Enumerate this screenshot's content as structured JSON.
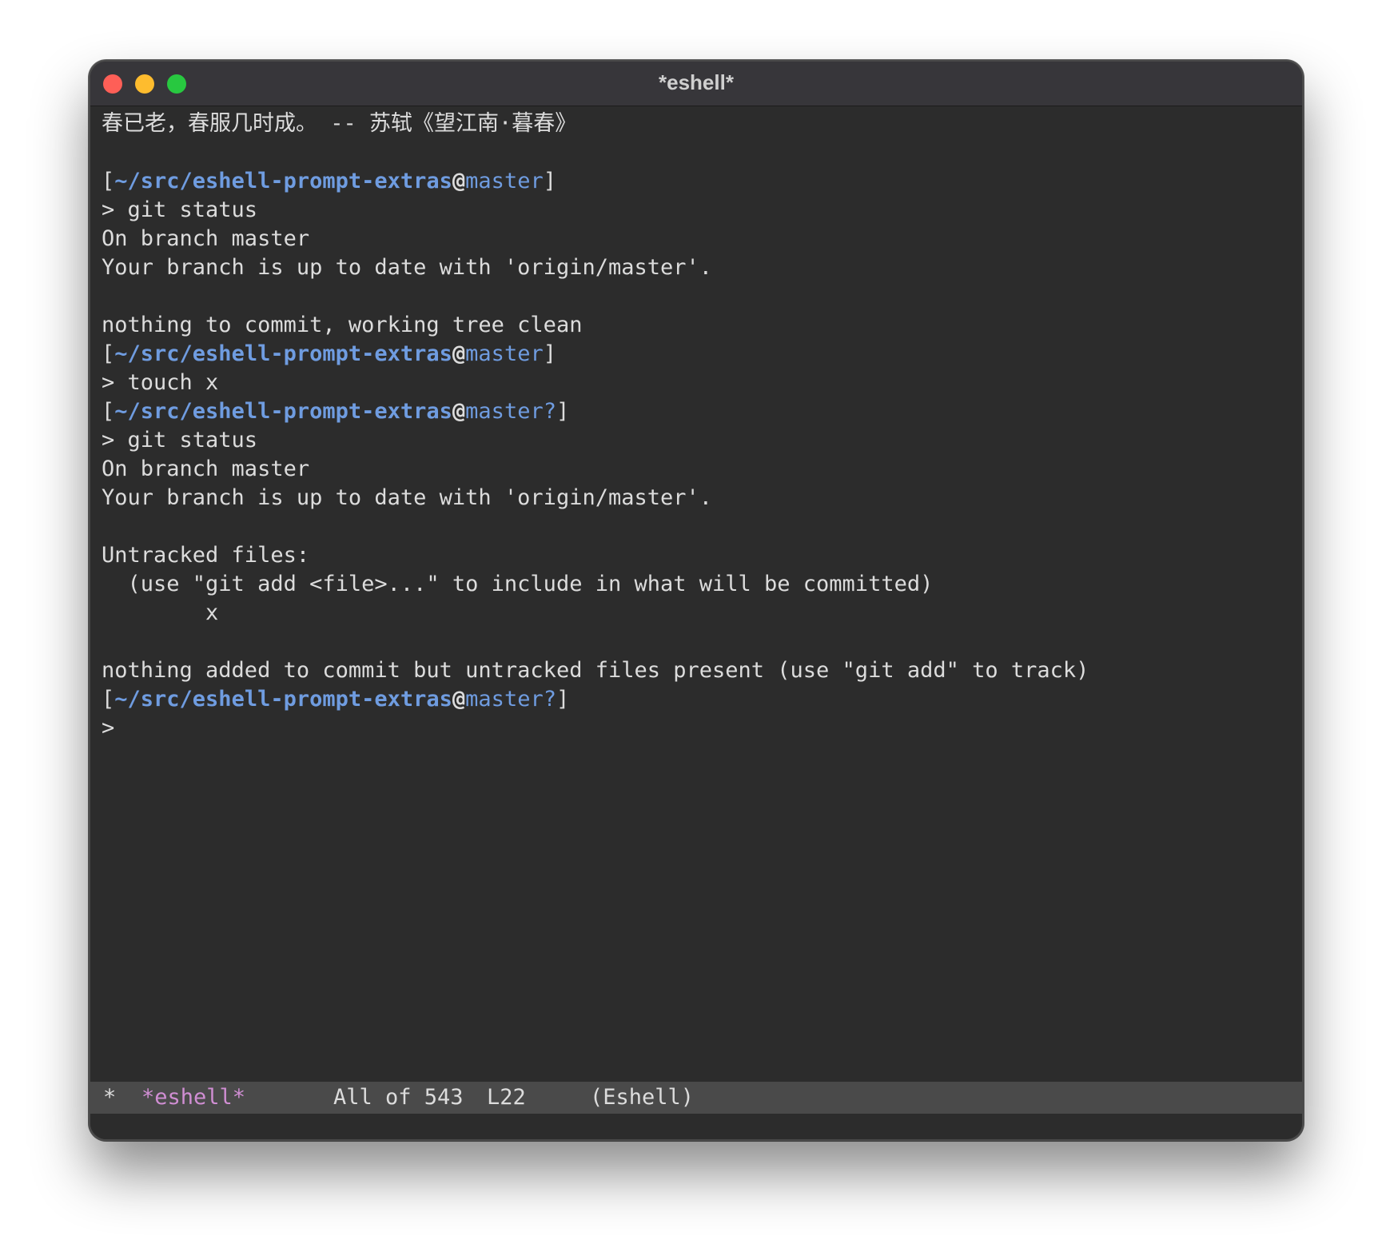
{
  "window": {
    "title": "*eshell*"
  },
  "buffer": {
    "banner": "春已老，春服几时成。 -- 苏轼《望江南·暮春》",
    "prompts": [
      {
        "path": "~/src/eshell-prompt-extras",
        "at": "@",
        "branch": "master"
      },
      {
        "path": "~/src/eshell-prompt-extras",
        "at": "@",
        "branch": "master"
      },
      {
        "path": "~/src/eshell-prompt-extras",
        "at": "@",
        "branch": "master?"
      },
      {
        "path": "~/src/eshell-prompt-extras",
        "at": "@",
        "branch": "master?"
      }
    ],
    "lines": {
      "cmd1": "> git status",
      "out1a": "On branch master",
      "out1b": "Your branch is up to date with 'origin/master'.",
      "out1c": "nothing to commit, working tree clean",
      "cmd2": "> touch x",
      "cmd3": "> git status",
      "out3a": "On branch master",
      "out3b": "Your branch is up to date with 'origin/master'.",
      "out3c": "Untracked files:",
      "out3d": "  (use \"git add <file>...\" to include in what will be committed)",
      "out3e": "        x",
      "out3f": "nothing added to commit but untracked files present (use \"git add\" to track)",
      "cmd4": ">"
    }
  },
  "modeline": {
    "modified": "*",
    "buffer_name": "*eshell*",
    "position": "All of 543",
    "line": "L22",
    "mode": "(Eshell)"
  }
}
